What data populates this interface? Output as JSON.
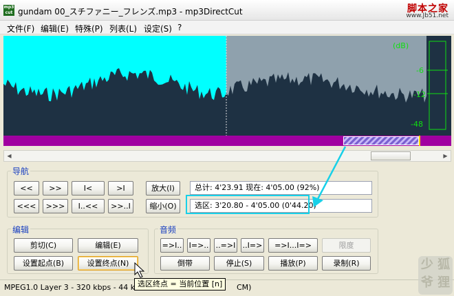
{
  "window": {
    "title": "gundam 00_スチファニー_フレンズ.mp3 - mp3DirectCut",
    "app_icon_text": "mp3 cut",
    "watermark_line1": "脚本之家",
    "watermark_line2": "www.Jb51.net"
  },
  "menu": [
    {
      "label": "文件(F)"
    },
    {
      "label": "编辑(E)"
    },
    {
      "label": "特殊(P)"
    },
    {
      "label": "列表(L)"
    },
    {
      "label": "设定(S)"
    },
    {
      "label": "?"
    }
  ],
  "waveform": {
    "db_labels": [
      "(dB)",
      "-6",
      "-12",
      "-48"
    ],
    "selected_color": "#00ffff",
    "wave_color": "#8fa1ad",
    "background_color": "#1e3143",
    "meter_color": "#10e010"
  },
  "timeline": {
    "bar_color": "#a000a0"
  },
  "navigation": {
    "label": "导航",
    "row1": [
      "<<",
      ">>",
      "I<",
      ">I"
    ],
    "row2": [
      "<<<",
      ">>>",
      "I..<<",
      ">>..I"
    ],
    "zoom_in": "放大(I)",
    "zoom_out": "缩小(O)",
    "total_text": "总计: 4'23.91  现在: 4'05.00  (92%)",
    "selection_text": "选区: 3'20.80 - 4'05.00 (0'44.20)"
  },
  "edit": {
    "label": "编辑",
    "cut": "剪切(C)",
    "edit": "编辑(E)",
    "set_start": "设置起点(B)",
    "set_end": "设置终点(N)"
  },
  "audio": {
    "label": "音频",
    "fade_buttons": [
      "=>I..",
      "I=>..",
      "..=>I",
      "..I=>",
      "=>I...I=>"
    ],
    "limit": "限度",
    "rewind": "倒带",
    "stop": "停止(S)",
    "play": "播放(P)",
    "record": "录制(R)"
  },
  "status": {
    "text": "MPEG1.0 Layer 3 - 320 kbps - 44 kHz - ",
    "tail": "CM)"
  },
  "tooltip": {
    "text": "选区终点 = 当前位置  [n]"
  },
  "badge": {
    "text": "少 狐\n爷 狸"
  }
}
